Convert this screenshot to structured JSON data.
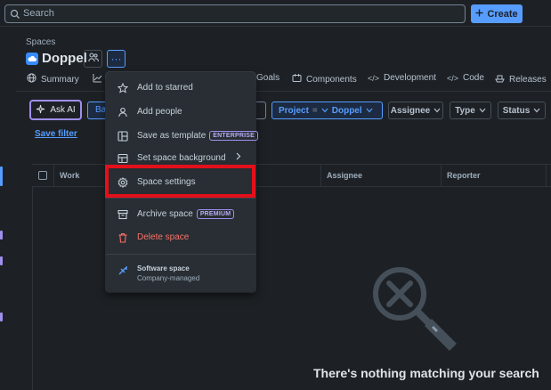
{
  "topbar": {
    "search_placeholder": "Search",
    "create_label": "Create"
  },
  "header": {
    "breadcrumb": "Spaces",
    "title": "Doppel",
    "more_label": "···"
  },
  "tabs": [
    {
      "label": "Summary",
      "icon": "globe-icon"
    },
    {
      "label": "Goals",
      "icon": ""
    },
    {
      "label": "Components",
      "icon": "components-icon"
    },
    {
      "label": "Development",
      "icon": "code-icon"
    },
    {
      "label": "Code",
      "icon": "code-icon"
    },
    {
      "label": "Releases",
      "icon": "ship-icon"
    }
  ],
  "filters": {
    "ask_ai": "Ask AI",
    "basic_label": "Ba",
    "project_key": "Project",
    "project_op": "=",
    "project_value": "Doppel",
    "assignee": "Assignee",
    "type": "Type",
    "status": "Status",
    "save_filter": "Save filter"
  },
  "table": {
    "columns": [
      "Work",
      "Assignee",
      "Reporter"
    ]
  },
  "empty_state": {
    "message": "There's nothing matching your search"
  },
  "menu": {
    "items": [
      {
        "label": "Add to starred",
        "icon": "star-icon"
      },
      {
        "label": "Add people",
        "icon": "person-icon"
      },
      {
        "label": "Save as template",
        "badge": "ENTERPRISE",
        "icon": "template-icon"
      },
      {
        "label": "Set space background",
        "icon": "image-icon"
      },
      {
        "label": "Space settings",
        "icon": "gear-icon"
      },
      {
        "label": "Archive space",
        "badge": "PREMIUM",
        "icon": "archive-icon"
      },
      {
        "label": "Delete space",
        "icon": "trash-icon"
      }
    ],
    "footer_title": "Software space",
    "footer_subtitle": "Company-managed"
  },
  "colors": {
    "accent": "#579dff",
    "highlight": "#e3101b",
    "ai": "#9f8fef",
    "danger": "#f87168"
  }
}
